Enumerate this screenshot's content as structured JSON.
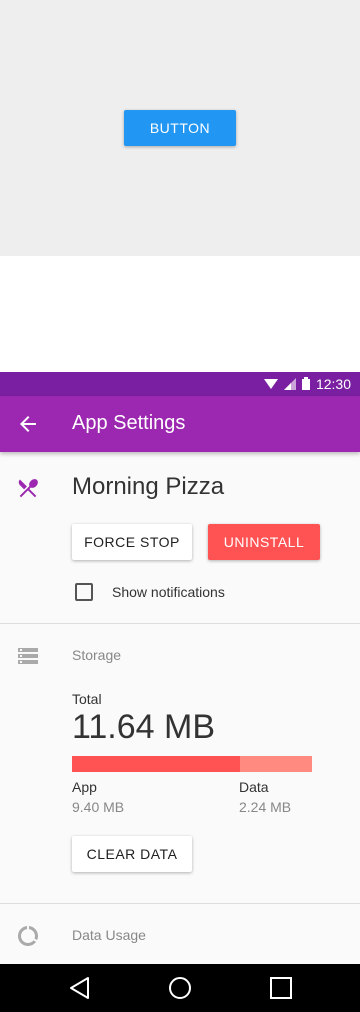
{
  "demo": {
    "button_label": "BUTTON"
  },
  "status_bar": {
    "time": "12:30"
  },
  "app_bar": {
    "title": "App Settings"
  },
  "app": {
    "name": "Morning Pizza",
    "force_stop_label": "FORCE STOP",
    "uninstall_label": "UNINSTALL",
    "notifications_label": "Show notifications",
    "notifications_checked": false
  },
  "storage": {
    "section_label": "Storage",
    "total_label": "Total",
    "total_value": "11.64 MB",
    "app_fraction": 0.7,
    "app_label": "App",
    "app_size": "9.40 MB",
    "data_label": "Data",
    "data_size": "2.24 MB",
    "clear_data_label": "CLEAR DATA"
  },
  "data_usage": {
    "section_label": "Data Usage"
  },
  "colors": {
    "primary": "#9c27b0",
    "primary_dark": "#7b1fa2",
    "accent": "#ff5252",
    "demo_button": "#2196f3"
  }
}
